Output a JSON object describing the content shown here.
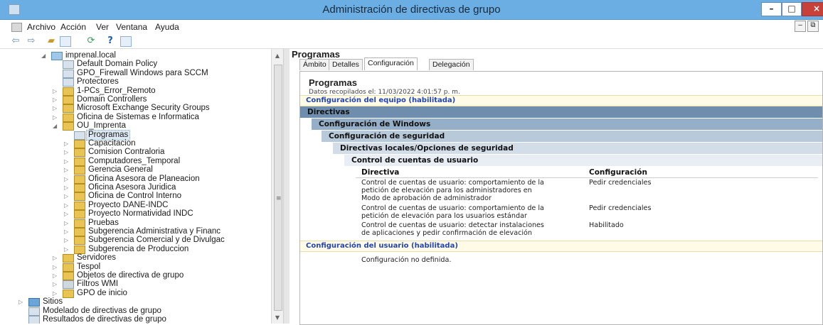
{
  "window": {
    "title": "Administración de directivas de grupo"
  },
  "menu": [
    "Archivo",
    "Acción",
    "Ver",
    "Ventana",
    "Ayuda"
  ],
  "tree": [
    {
      "label": "imprenal.local",
      "icon": "domain-icon"
    },
    {
      "label": "Default Domain Policy",
      "icon": "gpo-link-icon"
    },
    {
      "label": "GPO_Firewall Windows para SCCM",
      "icon": "gpo-link-icon"
    },
    {
      "label": "Protectores",
      "icon": "gpo-link-icon"
    },
    {
      "label": "1-PCs_Error_Remoto",
      "icon": "ou-folder-icon"
    },
    {
      "label": "Domain Controllers",
      "icon": "ou-folder-icon"
    },
    {
      "label": "Microsoft Exchange Security Groups",
      "icon": "ou-folder-icon"
    },
    {
      "label": "Oficina de Sistemas e Informatica",
      "icon": "ou-folder-icon"
    },
    {
      "label": "OU_Imprenta",
      "icon": "ou-folder-icon"
    },
    {
      "label": "Programas",
      "icon": "gpo-link-icon"
    },
    {
      "label": "Capacitacion",
      "icon": "ou-folder-icon"
    },
    {
      "label": "Comision Contraloria",
      "icon": "ou-folder-icon"
    },
    {
      "label": "Computadores_Temporal",
      "icon": "ou-folder-icon"
    },
    {
      "label": "Gerencia General",
      "icon": "ou-folder-icon"
    },
    {
      "label": "Oficina Asesora de Planeacion",
      "icon": "ou-folder-icon"
    },
    {
      "label": "Oficina Asesora Juridica",
      "icon": "ou-folder-icon"
    },
    {
      "label": "Oficina de Control Interno",
      "icon": "ou-folder-icon"
    },
    {
      "label": "Proyecto DANE-INDC",
      "icon": "ou-folder-icon"
    },
    {
      "label": "Proyecto Normatividad INDC",
      "icon": "ou-folder-icon"
    },
    {
      "label": "Pruebas",
      "icon": "ou-folder-icon"
    },
    {
      "label": "Subgerencia Administrativa y Financ",
      "icon": "ou-folder-icon"
    },
    {
      "label": "Subgerencia Comercial y de Divulgac",
      "icon": "ou-folder-icon"
    },
    {
      "label": "Subgerencia de Produccion",
      "icon": "ou-folder-icon"
    },
    {
      "label": "Servidores",
      "icon": "ou-folder-icon"
    },
    {
      "label": "Tespol",
      "icon": "ou-folder-icon"
    },
    {
      "label": "Objetos de directiva de grupo",
      "icon": "folder-icon"
    },
    {
      "label": "Filtros WMI",
      "icon": "wmi-folder-icon"
    },
    {
      "label": "GPO de inicio",
      "icon": "folder-icon"
    },
    {
      "label": "Sitios",
      "icon": "sites-icon"
    },
    {
      "label": "Modelado de directivas de grupo",
      "icon": "modeling-icon"
    },
    {
      "label": "Resultados de directivas de grupo",
      "icon": "results-icon"
    }
  ],
  "right": {
    "title": "Programas",
    "tabs": [
      "Ámbito",
      "Detalles",
      "Configuración",
      "Delegación"
    ],
    "active_tab": "Configuración",
    "report": {
      "title": "Programas",
      "date": "Datos recopilados el: 11/03/2022 4:01:57 p. m.",
      "computer_section": "Configuración del equipo (habilitada)",
      "headings": [
        "Directivas",
        "Configuración de Windows",
        "Configuración de seguridad",
        "Directivas locales/Opciones de seguridad",
        "Control de cuentas de usuario"
      ],
      "col_policy": "Directiva",
      "col_setting": "Configuración",
      "rows": [
        {
          "policy": [
            "Control de cuentas de usuario: comportamiento de la",
            "petición de elevación para los administradores en",
            "Modo de aprobación de administrador"
          ],
          "setting": "Pedir credenciales"
        },
        {
          "policy": [
            "Control de cuentas de usuario: comportamiento de la",
            "petición de elevación para los usuarios estándar"
          ],
          "setting": "Pedir credenciales"
        },
        {
          "policy": [
            "Control de cuentas de usuario: detectar instalaciones",
            "de aplicaciones y pedir confirmación de elevación"
          ],
          "setting": "Habilitado"
        }
      ],
      "user_section": "Configuración del usuario (habilitada)",
      "user_not_defined": "Configuración no definida."
    }
  },
  "colors": {
    "titlebar": "#6aaee4",
    "section_link": "#2144b8",
    "section_bg": "#fffbe7",
    "heading_1": "#6f8ead",
    "heading_2": "#94afc7"
  }
}
